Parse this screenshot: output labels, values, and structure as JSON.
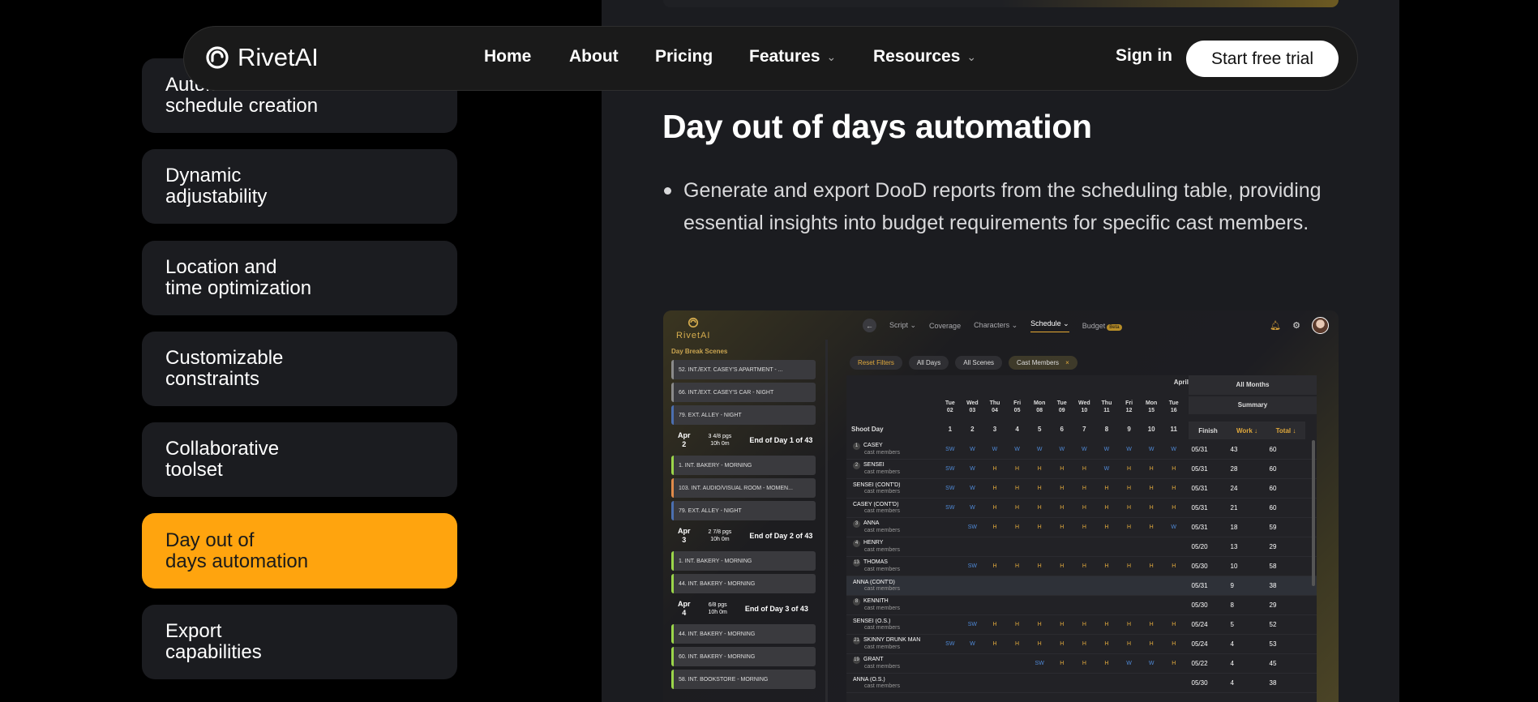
{
  "navbar": {
    "brand": "RivetAI",
    "links": [
      {
        "label": "Home"
      },
      {
        "label": "About"
      },
      {
        "label": "Pricing"
      },
      {
        "label": "Features",
        "dropdown": true
      },
      {
        "label": "Resources",
        "dropdown": true
      }
    ],
    "sign_in": "Sign in",
    "cta": "Start free trial"
  },
  "sidebar": {
    "items": [
      {
        "label": "Automated\nschedule creation",
        "active": false
      },
      {
        "label": "Dynamic\nadjustability",
        "active": false
      },
      {
        "label": "Location and\ntime optimization",
        "active": false
      },
      {
        "label": "Customizable\nconstraints",
        "active": false
      },
      {
        "label": "Collaborative\ntoolset",
        "active": false
      },
      {
        "label": "Day out of\ndays automation",
        "active": true
      },
      {
        "label": "Export\ncapabilities",
        "active": false
      }
    ]
  },
  "content": {
    "title": "Day out of days automation",
    "bullets": [
      "Generate and export DooD reports from the scheduling table, providing essential insights into budget requirements for specific cast members."
    ]
  },
  "colors": {
    "accent": "#ffa40e",
    "panel": "#1b1c20",
    "background": "#000000"
  },
  "app_screenshot": {
    "brand": "RivetAI",
    "tabs": [
      {
        "label": "Script ⌄",
        "active": false
      },
      {
        "label": "Coverage",
        "active": false
      },
      {
        "label": "Characters ⌄",
        "active": false
      },
      {
        "label": "Schedule ⌄",
        "active": true
      },
      {
        "label": "Budget",
        "badge": "Beta",
        "active": false
      }
    ],
    "left_title": "Day Break Scenes",
    "scenes": [
      {
        "type": "scene",
        "text": "52. INT./EXT. CASEY'S APARTMENT - ...",
        "color": "#8a8a8a"
      },
      {
        "type": "scene",
        "text": "66. INT./EXT. CASEY'S CAR - NIGHT",
        "color": "#8a8a8a"
      },
      {
        "type": "scene",
        "text": "79. EXT. ALLEY - NIGHT",
        "color": "#4b6fb0"
      },
      {
        "type": "end",
        "month": "Apr",
        "day": "2",
        "pages": "3 4/8 pgs",
        "time": "10h 0m",
        "label": "End of Day 1 of 43"
      },
      {
        "type": "scene",
        "text": "1. INT. BAKERY - MORNING",
        "color": "#9bd64a"
      },
      {
        "type": "scene",
        "text": "103. INT. AUDIO/VISUAL ROOM - MOMEN...",
        "color": "#e08a4a"
      },
      {
        "type": "scene",
        "text": "79. EXT. ALLEY - NIGHT",
        "color": "#4b6fb0"
      },
      {
        "type": "end",
        "month": "Apr",
        "day": "3",
        "pages": "2 7/8 pgs",
        "time": "10h 0m",
        "label": "End of Day 2 of 43"
      },
      {
        "type": "scene",
        "text": "1. INT. BAKERY - MORNING",
        "color": "#9bd64a"
      },
      {
        "type": "scene",
        "text": "44. INT. BAKERY - MORNING",
        "color": "#9bd64a"
      },
      {
        "type": "end",
        "month": "Apr",
        "day": "4",
        "pages": "6/8 pgs",
        "time": "10h 0m",
        "label": "End of Day 3 of 43"
      },
      {
        "type": "scene",
        "text": "44. INT. BAKERY - MORNING",
        "color": "#9bd64a"
      },
      {
        "type": "scene",
        "text": "60. INT. BAKERY - MORNING",
        "color": "#9bd64a"
      },
      {
        "type": "scene",
        "text": "58. INT. BOOKSTORE - MORNING",
        "color": "#9bd64a"
      }
    ],
    "filters": [
      {
        "label": "Reset Filters",
        "kind": "reset"
      },
      {
        "label": "All Days",
        "kind": "normal"
      },
      {
        "label": "All Scenes",
        "kind": "normal"
      },
      {
        "label": "Cast Members",
        "kind": "highlight",
        "close": "×"
      }
    ],
    "month": "April",
    "all_months": "All Months",
    "summary": "Summary",
    "shoot_day": "Shoot Day",
    "days": [
      {
        "wd": "Tue",
        "d": "02",
        "n": "1"
      },
      {
        "wd": "Wed",
        "d": "03",
        "n": "2"
      },
      {
        "wd": "Thu",
        "d": "04",
        "n": "3"
      },
      {
        "wd": "Fri",
        "d": "05",
        "n": "4"
      },
      {
        "wd": "Mon",
        "d": "08",
        "n": "5"
      },
      {
        "wd": "Tue",
        "d": "09",
        "n": "6"
      },
      {
        "wd": "Wed",
        "d": "10",
        "n": "7"
      },
      {
        "wd": "Thu",
        "d": "11",
        "n": "8"
      },
      {
        "wd": "Fri",
        "d": "12",
        "n": "9"
      },
      {
        "wd": "Mon",
        "d": "15",
        "n": "10"
      },
      {
        "wd": "Tue",
        "d": "16",
        "n": "11"
      }
    ],
    "summary_cols": [
      "Finish",
      "Work ↓",
      "Total ↓"
    ],
    "rows": [
      {
        "num": "1",
        "name": "CASEY",
        "sub": "cast members",
        "cells": [
          "SW",
          "W",
          "W",
          "W",
          "W",
          "W",
          "W",
          "W",
          "W",
          "W",
          "W"
        ],
        "finish": "05/31",
        "work": "43",
        "total": "60"
      },
      {
        "num": "2",
        "name": "SENSEI",
        "sub": "cast members",
        "cells": [
          "SW",
          "W",
          "H",
          "H",
          "H",
          "H",
          "H",
          "W",
          "H",
          "H",
          "H"
        ],
        "finish": "05/31",
        "work": "28",
        "total": "60"
      },
      {
        "num": "",
        "name": "SENSEI (CONT'D)",
        "sub": "cast members",
        "cells": [
          "SW",
          "W",
          "H",
          "H",
          "H",
          "H",
          "H",
          "H",
          "H",
          "H",
          "H"
        ],
        "finish": "05/31",
        "work": "24",
        "total": "60"
      },
      {
        "num": "",
        "name": "CASEY (CONT'D)",
        "sub": "cast members",
        "cells": [
          "SW",
          "W",
          "H",
          "H",
          "H",
          "H",
          "H",
          "H",
          "H",
          "H",
          "H"
        ],
        "finish": "05/31",
        "work": "21",
        "total": "60"
      },
      {
        "num": "3",
        "name": "ANNA",
        "sub": "cast members",
        "cells": [
          "",
          "SW",
          "H",
          "H",
          "H",
          "H",
          "H",
          "H",
          "H",
          "H",
          "W"
        ],
        "finish": "05/31",
        "work": "18",
        "total": "59"
      },
      {
        "num": "4",
        "name": "HENRY",
        "sub": "cast members",
        "cells": [
          "",
          "",
          "",
          "",
          "",
          "",
          "",
          "",
          "",
          "",
          ""
        ],
        "finish": "05/20",
        "work": "13",
        "total": "29"
      },
      {
        "num": "13",
        "name": "THOMAS",
        "sub": "cast members",
        "cells": [
          "",
          "SW",
          "H",
          "H",
          "H",
          "H",
          "H",
          "H",
          "H",
          "H",
          "H"
        ],
        "finish": "05/30",
        "work": "10",
        "total": "58"
      },
      {
        "num": "",
        "name": "ANNA (CONT'D)",
        "sub": "cast members",
        "cells": [
          "",
          "",
          "",
          "",
          "",
          "",
          "",
          "",
          "",
          "",
          ""
        ],
        "finish": "05/31",
        "work": "9",
        "total": "38",
        "highlight": true
      },
      {
        "num": "8",
        "name": "KENNITH",
        "sub": "cast members",
        "cells": [
          "",
          "",
          "",
          "",
          "",
          "",
          "",
          "",
          "",
          "",
          ""
        ],
        "finish": "05/30",
        "work": "8",
        "total": "29"
      },
      {
        "num": "",
        "name": "SENSEI (O.S.)",
        "sub": "cast members",
        "cells": [
          "",
          "SW",
          "H",
          "H",
          "H",
          "H",
          "H",
          "H",
          "H",
          "H",
          "H"
        ],
        "finish": "05/24",
        "work": "5",
        "total": "52"
      },
      {
        "num": "21",
        "name": "SKINNY DRUNK MAN",
        "sub": "cast members",
        "cells": [
          "SW",
          "W",
          "H",
          "H",
          "H",
          "H",
          "H",
          "H",
          "H",
          "H",
          "H"
        ],
        "finish": "05/24",
        "work": "4",
        "total": "53"
      },
      {
        "num": "19",
        "name": "GRANT",
        "sub": "cast members",
        "cells": [
          "",
          "",
          "",
          "",
          "SW",
          "H",
          "H",
          "H",
          "W",
          "W",
          "H"
        ],
        "finish": "05/22",
        "work": "4",
        "total": "45"
      },
      {
        "num": "",
        "name": "ANNA (O.S.)",
        "sub": "cast members",
        "cells": [
          "",
          "",
          "",
          "",
          "",
          "",
          "",
          "",
          "",
          "",
          ""
        ],
        "finish": "05/30",
        "work": "4",
        "total": "38"
      }
    ]
  }
}
